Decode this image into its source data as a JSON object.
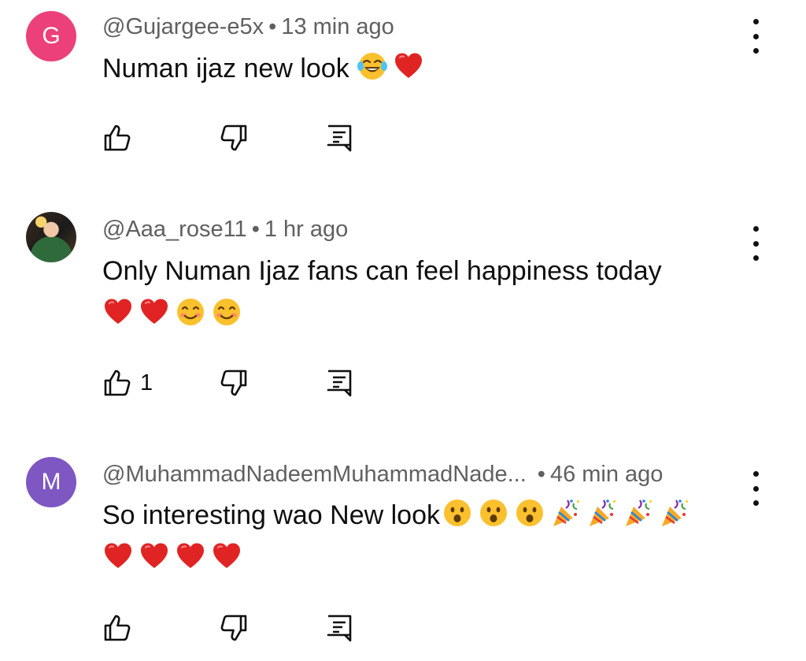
{
  "comments": [
    {
      "avatar_letter": "G",
      "avatar_color": "#ec407a",
      "author": "@Gujargee-e5x",
      "time": "13 min ago",
      "text": "Numan ijaz new look",
      "emojis": [
        "joy-emoji",
        "red-heart-emoji"
      ],
      "likes": ""
    },
    {
      "avatar_letter": "",
      "avatar_color": "",
      "author": "@Aaa_rose11",
      "time": "1 hr ago",
      "text": "Only Numan Ijaz fans can feel happiness today",
      "emojis": [
        "red-heart-emoji",
        "red-heart-emoji",
        "smiling-emoji",
        "smiling-emoji"
      ],
      "likes": "1"
    },
    {
      "avatar_letter": "M",
      "avatar_color": "#7e57c2",
      "author": "@MuhammadNadeemMuhammadNade...",
      "time": "46 min ago",
      "text": "So interesting wao New look",
      "emojis": [
        "astonished-emoji",
        "astonished-emoji",
        "astonished-emoji",
        "party-popper-emoji",
        "party-popper-emoji",
        "party-popper-emoji",
        "party-popper-emoji",
        "red-heart-emoji",
        "red-heart-emoji",
        "red-heart-emoji",
        "red-heart-emoji"
      ],
      "likes": ""
    }
  ],
  "separator": "•",
  "icons": {
    "more": "more-vert-icon",
    "like": "thumb-up-icon",
    "dislike": "thumb-down-icon",
    "reply": "reply-comment-icon"
  },
  "colors": {
    "meta_text": "#606060",
    "body_text": "#0f0f0f",
    "background": "#ffffff"
  }
}
